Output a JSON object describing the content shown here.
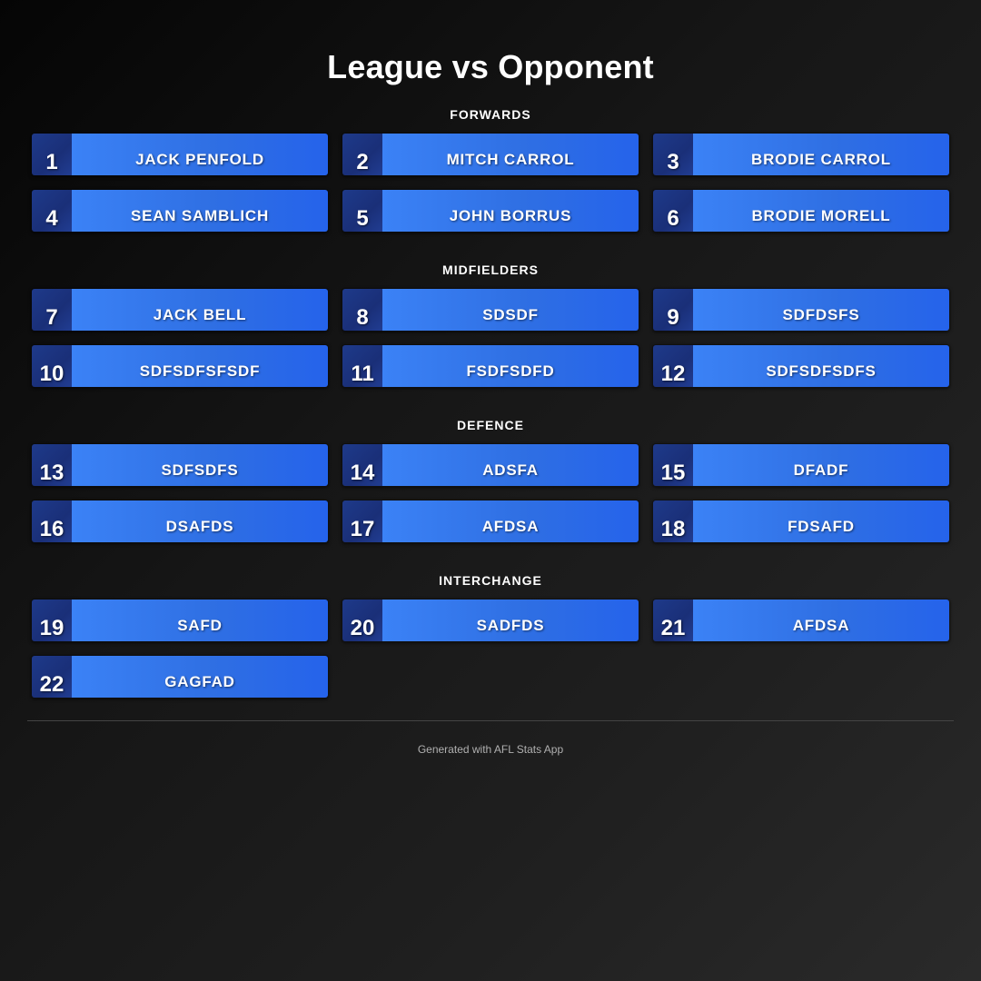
{
  "header": {
    "title": "League vs Opponent"
  },
  "sections": [
    {
      "label": "FORWARDS",
      "players": [
        {
          "number": "1",
          "name": "JACK PENFOLD"
        },
        {
          "number": "2",
          "name": "MITCH CARROL"
        },
        {
          "number": "3",
          "name": "BRODIE CARROL"
        },
        {
          "number": "4",
          "name": "SEAN SAMBLICH"
        },
        {
          "number": "5",
          "name": "JOHN BORRUS"
        },
        {
          "number": "6",
          "name": "BRODIE MORELL"
        }
      ]
    },
    {
      "label": "MIDFIELDERS",
      "players": [
        {
          "number": "7",
          "name": "JACK BELL"
        },
        {
          "number": "8",
          "name": "SDSDF"
        },
        {
          "number": "9",
          "name": "SDFDSFS"
        },
        {
          "number": "10",
          "name": "SDFSDFSFSDF"
        },
        {
          "number": "11",
          "name": "FSDFSDFD"
        },
        {
          "number": "12",
          "name": "SDFSDFSDFS"
        }
      ]
    },
    {
      "label": "DEFENCE",
      "players": [
        {
          "number": "13",
          "name": "SDFSDFS"
        },
        {
          "number": "14",
          "name": "ADSFA"
        },
        {
          "number": "15",
          "name": "DFADF"
        },
        {
          "number": "16",
          "name": "DSAFDS"
        },
        {
          "number": "17",
          "name": "AFDSA"
        },
        {
          "number": "18",
          "name": "FDSAFD"
        }
      ]
    },
    {
      "label": "INTERCHANGE",
      "players": [
        {
          "number": "19",
          "name": "SAFD"
        },
        {
          "number": "20",
          "name": "SADFDS"
        },
        {
          "number": "21",
          "name": "AFDSA"
        },
        {
          "number": "22",
          "name": "GAGFAD"
        }
      ]
    }
  ],
  "footer": {
    "text": "Generated with AFL Stats App"
  },
  "colors": {
    "card_name_bg": "#3b82f6",
    "card_number_bg": "#1e3a8a",
    "background": "#1a1a1a"
  }
}
